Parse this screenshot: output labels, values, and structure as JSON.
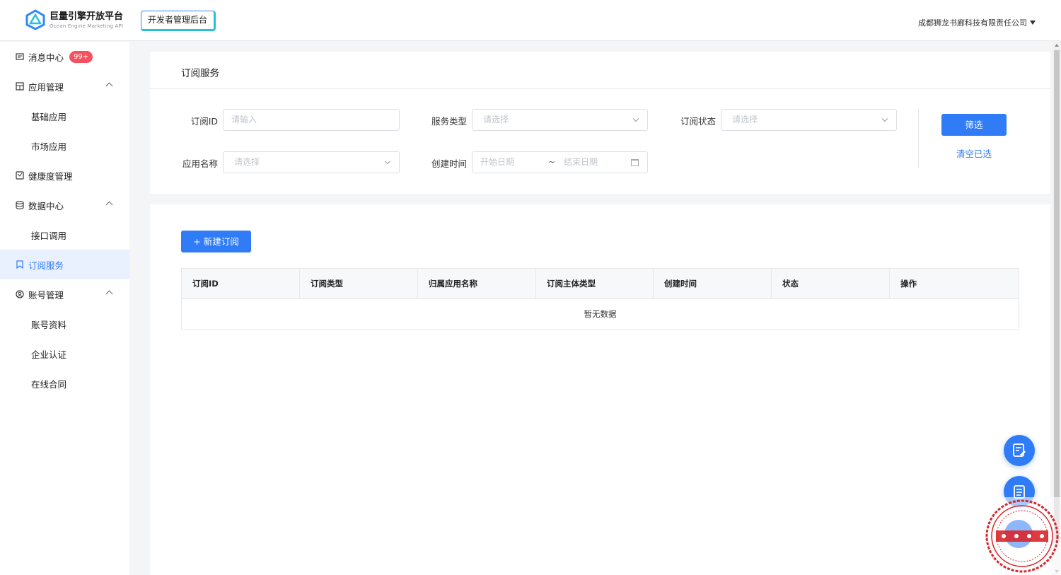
{
  "header": {
    "logo_title": "巨量引擎开放平台",
    "logo_subtitle": "Ocean Engine Marketing API",
    "console_badge": "开发者管理后台",
    "company": "成都狮龙书廊科技有限责任公司"
  },
  "sidebar": {
    "items": [
      {
        "label": "消息中心",
        "icon": "message-icon",
        "badge": "99+"
      },
      {
        "label": "应用管理",
        "icon": "app-icon",
        "expanded": true
      },
      {
        "label": "基础应用"
      },
      {
        "label": "市场应用"
      },
      {
        "label": "健康度管理",
        "icon": "health-icon"
      },
      {
        "label": "数据中心",
        "icon": "database-icon",
        "expanded": true
      },
      {
        "label": "接口调用"
      },
      {
        "label": "订阅服务",
        "icon": "bookmark-icon",
        "active": true
      },
      {
        "label": "账号管理",
        "icon": "account-icon",
        "expanded": true
      },
      {
        "label": "账号资料"
      },
      {
        "label": "企业认证"
      },
      {
        "label": "在线合同"
      }
    ]
  },
  "filter": {
    "title": "订阅服务",
    "sub_id_label": "订阅ID",
    "sub_id_placeholder": "请输入",
    "service_type_label": "服务类型",
    "service_type_placeholder": "请选择",
    "sub_status_label": "订阅状态",
    "sub_status_placeholder": "请选择",
    "app_name_label": "应用名称",
    "app_name_placeholder": "请选择",
    "created_label": "创建时间",
    "start_date": "开始日期",
    "date_separator": "~",
    "end_date": "结束日期",
    "filter_button": "筛选",
    "clear_link": "清空已选"
  },
  "table": {
    "new_button": "+ 新建订阅",
    "columns": [
      "订阅ID",
      "订阅类型",
      "归属应用名称",
      "订阅主体类型",
      "创建时间",
      "状态",
      "操作"
    ],
    "empty_text": "暂无数据"
  },
  "colors": {
    "primary": "#2f7cf6",
    "badge": "#f5515f",
    "active_bg": "#e9f1fe"
  }
}
